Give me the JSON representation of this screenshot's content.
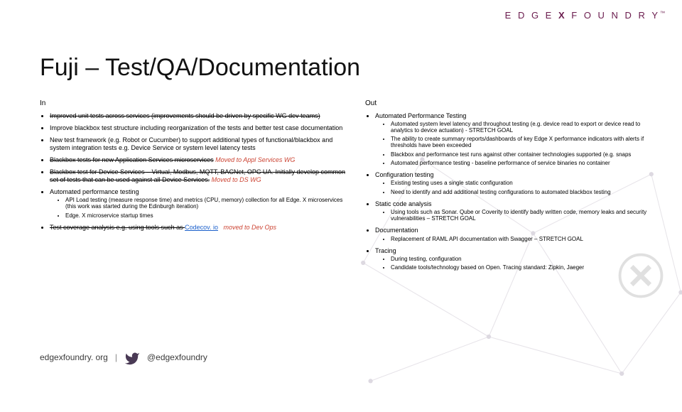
{
  "brand": {
    "left": "E D G E",
    "x": "X",
    "right": "F O U N D R Y",
    "tm": "™"
  },
  "title": "Fuji – Test/QA/Documentation",
  "in": {
    "head": "In",
    "items": [
      {
        "raw": "<span class='strike'>Improved unit tests across services (improvements should be driven by specific WG dev teams)</span>"
      },
      {
        "raw": "Improve blackbox test structure including reorganization of the tests and better test case documentation"
      },
      {
        "raw": "New test framework (e.g. Robot or Cucumber) to support additional types of functional/blackbox and system integration tests e.g. Device Service or system level latency tests"
      },
      {
        "raw": "<span class='strike'>Blackbox tests for new Application Services microservices</span> <span class='arrow'>Moved to Appl Services WG</span>"
      },
      {
        "raw": "<span class='strike'>Blackbox test for Device Services – Virtual, Modbus, MQTT, BACNet, OPC UA. Initially develop common set of tests that can be used against all Device Services.</span> <span class='arrow'>Moved to DS WG</span>"
      },
      {
        "raw": "Automated performance testing",
        "sub": [
          "API Load testing (measure response time) and metrics (CPU, memory) collection for all Edge. X microservices (this work was started during the Edinburgh iteration)",
          "Edge. X microservice startup times"
        ]
      },
      {
        "raw": "<span class='strike'>Test coverage analysis e.g. using tools such as </span><a class='link' href='#'>Codecov. io</a> &nbsp;&nbsp;<span class='arrow'>moved to Dev Ops</span>"
      }
    ]
  },
  "out": {
    "head": "Out",
    "items": [
      {
        "raw": "Automated Performance Testing",
        "sub": [
          "Automated system level latency and throughout testing (e.g. device read to export or device read to analytics to device actuation) - STRETCH GOAL",
          "The ability to create summary reports/dashboards of key Edge X performance indicators with alerts if thresholds have been exceeded",
          "Blackbox and performance test runs against other container technologies supported (e.g. snaps",
          "Automated performance testing - baseline performance of service binaries no container"
        ]
      },
      {
        "raw": "Configuration testing",
        "sub": [
          "Existing testing uses a single static configuration",
          "Need to identify and add additional testing configurations to automated blackbox testing"
        ]
      },
      {
        "raw": "Static code analysis",
        "sub": [
          "Using tools such as Sonar. Qube or Coverity to identify badly written code, memory leaks and security vulnerabilities – STRETCH GOAL"
        ]
      },
      {
        "raw": "Documentation",
        "sub": [
          "Replacement of RAML API documentation with Swagger – STRETCH GOAL"
        ]
      },
      {
        "raw": "Tracing",
        "sub": [
          "During testing, configuration",
          "Candidate tools/technology based on Open. Tracing standard: Zipkin, Jaeger"
        ]
      }
    ]
  },
  "footer": {
    "site": "edgexfoundry. org",
    "handle": "@edgexfoundry"
  }
}
